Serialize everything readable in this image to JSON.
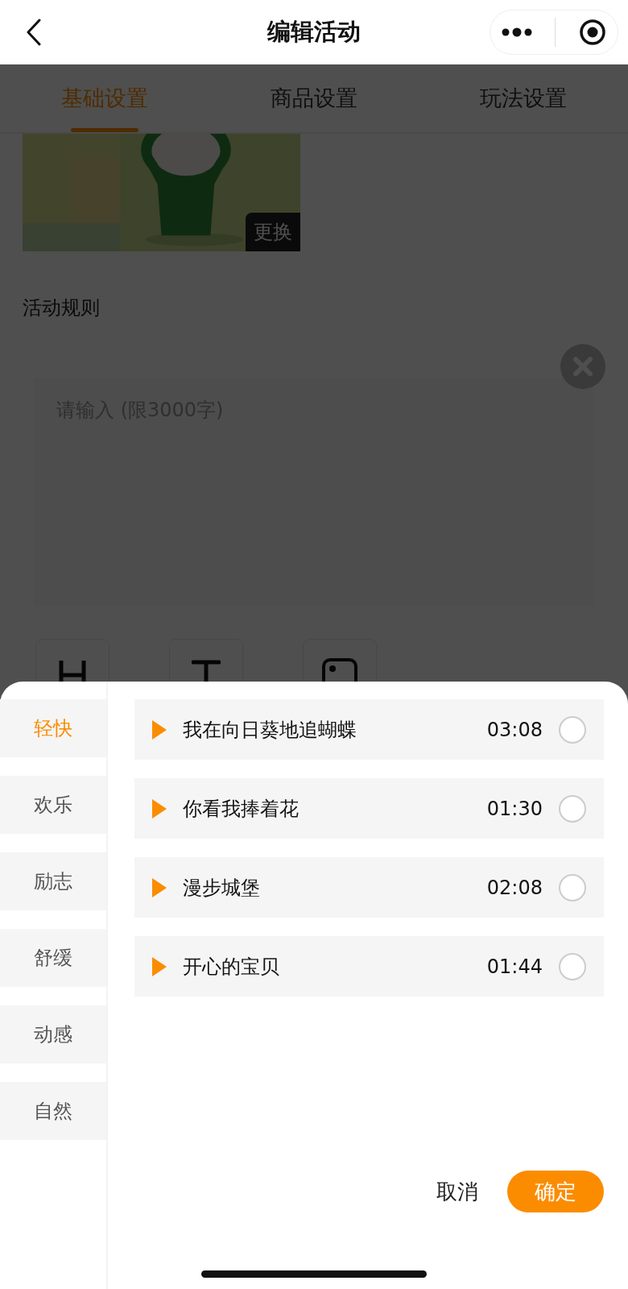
{
  "nav": {
    "title": "编辑活动"
  },
  "tabs": [
    {
      "label": "基础设置",
      "selected": true
    },
    {
      "label": "商品设置",
      "selected": false
    },
    {
      "label": "玩法设置",
      "selected": false
    }
  ],
  "cover": {
    "change_button": "更换"
  },
  "rules": {
    "label": "活动规则",
    "placeholder": "请输入 (限3000字)"
  },
  "picker": {
    "categories": [
      {
        "label": "轻快",
        "selected": true
      },
      {
        "label": "欢乐",
        "selected": false
      },
      {
        "label": "励志",
        "selected": false
      },
      {
        "label": "舒缓",
        "selected": false
      },
      {
        "label": "动感",
        "selected": false
      },
      {
        "label": "自然",
        "selected": false
      }
    ],
    "songs": [
      {
        "title": "我在向日葵地追蝴蝶",
        "duration": "03:08",
        "selected": false
      },
      {
        "title": "你看我捧着花",
        "duration": "01:30",
        "selected": false
      },
      {
        "title": "漫步城堡",
        "duration": "02:08",
        "selected": false
      },
      {
        "title": "开心的宝贝",
        "duration": "01:44",
        "selected": false
      }
    ],
    "cancel": "取消",
    "confirm": "确定"
  }
}
